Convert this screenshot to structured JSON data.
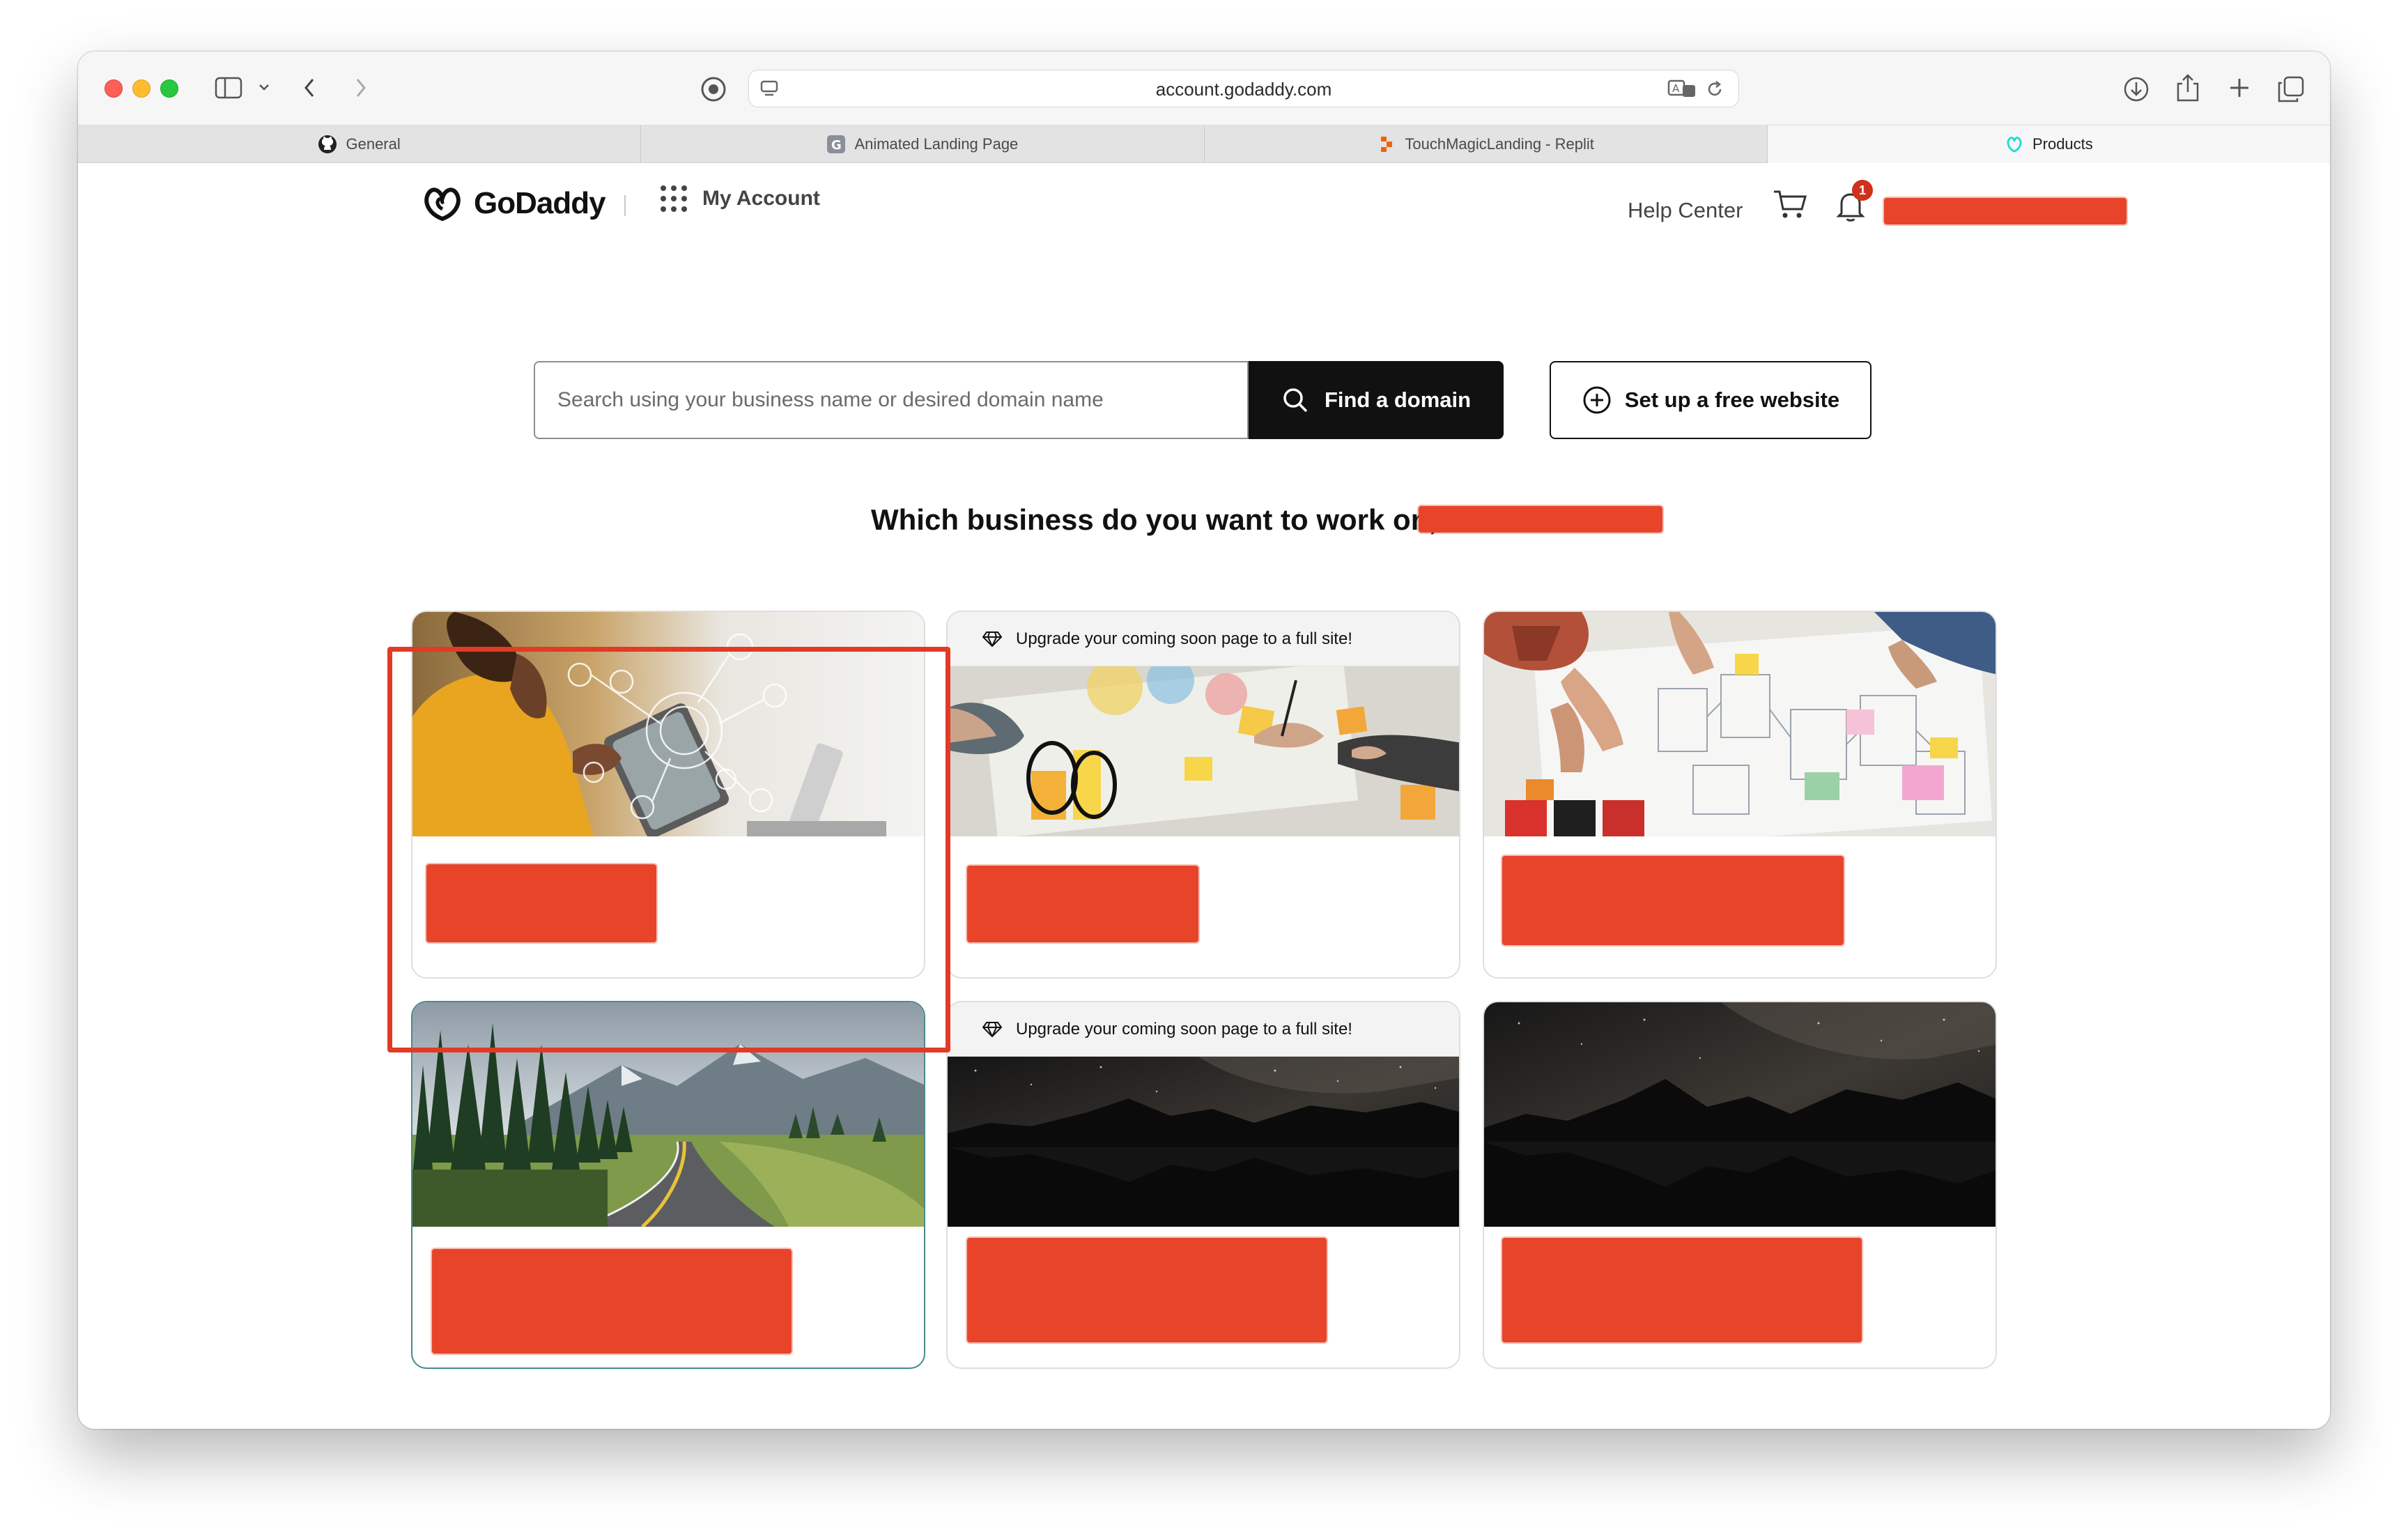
{
  "browser": {
    "url": "account.godaddy.com",
    "tabs": [
      {
        "label": "General",
        "icon": "github-icon"
      },
      {
        "label": "Animated Landing Page",
        "icon": "g-favicon-icon"
      },
      {
        "label": "TouchMagicLanding - Replit",
        "icon": "replit-icon"
      },
      {
        "label": "Products",
        "icon": "godaddy-favicon-icon"
      }
    ]
  },
  "header": {
    "logo_text": "GoDaddy",
    "my_account": "My Account",
    "help_center": "Help Center",
    "notification_count": "1"
  },
  "search": {
    "placeholder": "Search using your business name or desired domain name",
    "find_button": "Find a domain",
    "setup_button": "Set up a free website"
  },
  "prompt": {
    "question": "Which business do you want to work on,"
  },
  "cards": [
    {
      "banner": "",
      "image": "business-woman-tablet"
    },
    {
      "banner": "Upgrade your coming soon page to a full site!",
      "image": "team-desk-charts"
    },
    {
      "banner": "",
      "image": "team-wireframes"
    },
    {
      "banner": "",
      "image": "mountain-road"
    },
    {
      "banner": "Upgrade your coming soon page to a full site!",
      "image": "night-lake"
    },
    {
      "banner": "",
      "image": "night-lake"
    }
  ],
  "colors": {
    "accent_dark": "#111111",
    "redaction": "#e8442a",
    "badge": "#d0311c",
    "highlight_border": "#4a8b8b"
  }
}
